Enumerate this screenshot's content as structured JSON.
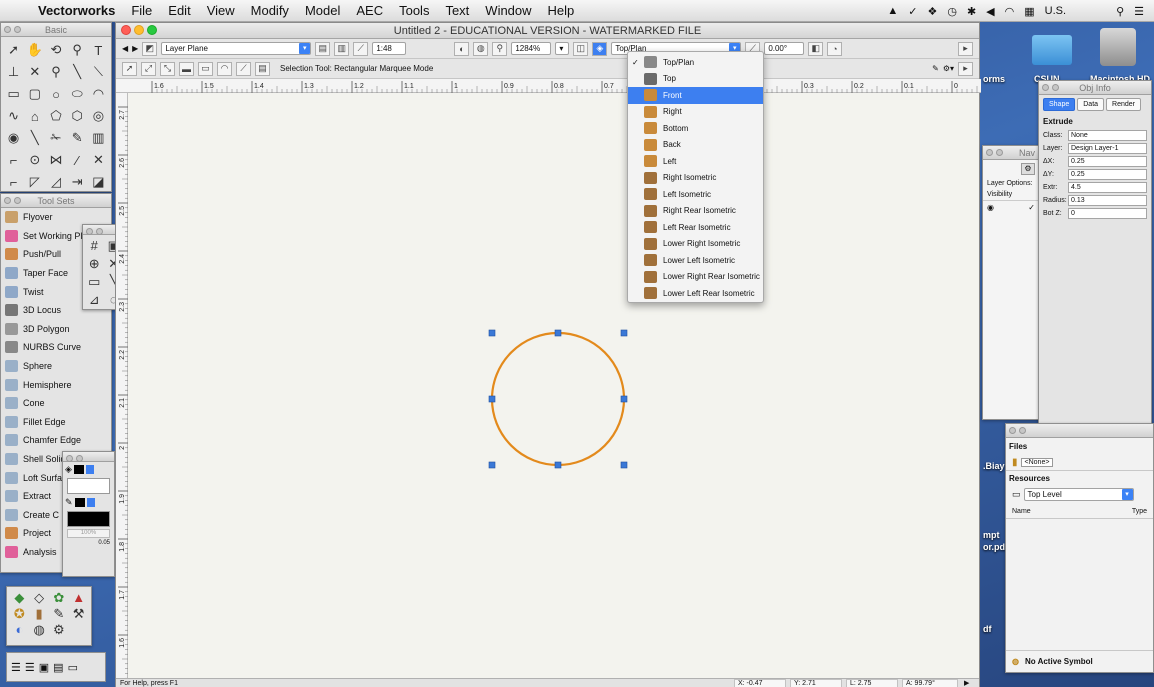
{
  "menubar": {
    "app": "Vectorworks",
    "items": [
      "File",
      "Edit",
      "View",
      "Modify",
      "Model",
      "AEC",
      "Tools",
      "Text",
      "Window",
      "Help"
    ],
    "status_locale": "U.S."
  },
  "basic_palette": {
    "title": "Basic"
  },
  "toolsets_palette": {
    "title": "Tool Sets",
    "tools": [
      {
        "label": "Flyover",
        "icon": "flyover-icon",
        "color": "#c9a06a"
      },
      {
        "label": "Set Working Pl...",
        "icon": "working-plane-icon",
        "color": "#e0609a"
      },
      {
        "label": "Push/Pull",
        "icon": "push-pull-icon",
        "color": "#d08a4a"
      },
      {
        "label": "Taper Face",
        "icon": "taper-face-icon",
        "color": "#8fa8c8"
      },
      {
        "label": "Twist",
        "icon": "twist-icon",
        "color": "#8fa8c8"
      },
      {
        "label": "3D Locus",
        "icon": "locus-icon",
        "color": "#777777"
      },
      {
        "label": "3D Polygon",
        "icon": "polygon-3d-icon",
        "color": "#999999"
      },
      {
        "label": "NURBS Curve",
        "icon": "nurbs-curve-icon",
        "color": "#888888"
      },
      {
        "label": "Sphere",
        "icon": "sphere-icon",
        "color": "#9ab0c8"
      },
      {
        "label": "Hemisphere",
        "icon": "hemisphere-icon",
        "color": "#9ab0c8"
      },
      {
        "label": "Cone",
        "icon": "cone-icon",
        "color": "#9ab0c8"
      },
      {
        "label": "Fillet Edge",
        "icon": "fillet-edge-icon",
        "color": "#9ab0c8"
      },
      {
        "label": "Chamfer Edge",
        "icon": "chamfer-edge-icon",
        "color": "#9ab0c8"
      },
      {
        "label": "Shell Solid",
        "icon": "shell-solid-icon",
        "color": "#9ab0c8"
      },
      {
        "label": "Loft Surfa",
        "icon": "loft-surface-icon",
        "color": "#9ab0c8"
      },
      {
        "label": "Extract",
        "icon": "extract-icon",
        "color": "#9ab0c8"
      },
      {
        "label": "Create C",
        "icon": "create-contours-icon",
        "color": "#9ab0c8"
      },
      {
        "label": "Project",
        "icon": "project-icon",
        "color": "#d08a4a"
      },
      {
        "label": "Analysis",
        "icon": "analysis-icon",
        "color": "#e0609a"
      }
    ]
  },
  "attributes": {
    "opacity": "100%",
    "line_weight": "0.05"
  },
  "window": {
    "title": "Untitled 2 - EDUCATIONAL VERSION - WATERMARKED FILE",
    "layer_field": "Layer Plane",
    "scale_field": "1:48",
    "zoom_field": "1284%",
    "view_field": "Top/Plan",
    "angle_field": "0.00°",
    "mode_text": "Selection Tool: Rectangular Marquee Mode",
    "ruler_ticks": [
      "1.6",
      "1.5",
      "1.4",
      "1.3",
      "1.2",
      "1.1",
      "1",
      "0.9",
      "0.8",
      "0.7",
      "0.4",
      "0.3",
      "0.2",
      "0.1",
      "0"
    ],
    "ruler_v_ticks": [
      "2.7",
      "2.6",
      "2.5",
      "2.4",
      "2.3",
      "2.2",
      "2.1",
      "2",
      "1.9",
      "1.8",
      "1.7",
      "1.6"
    ],
    "status": {
      "help": "For Help, press F1",
      "x": "X: -0.47",
      "y": "Y: 2.71",
      "l": "L: 2.75",
      "a": "A: 99.79°"
    }
  },
  "view_menu": {
    "selected": "Front",
    "items": [
      {
        "label": "Top/Plan",
        "checked": true,
        "icon": "top-plan-icon",
        "color": "#888888"
      },
      {
        "label": "Top",
        "icon": "top-view-icon",
        "color": "#6a6a6a"
      },
      {
        "label": "Front",
        "icon": "front-view-icon",
        "color": "#c98a3a"
      },
      {
        "label": "Right",
        "icon": "right-view-icon",
        "color": "#c98a3a"
      },
      {
        "label": "Bottom",
        "icon": "bottom-view-icon",
        "color": "#c98a3a"
      },
      {
        "label": "Back",
        "icon": "back-view-icon",
        "color": "#c98a3a"
      },
      {
        "label": "Left",
        "icon": "left-view-icon",
        "color": "#c98a3a"
      },
      {
        "label": "Right Isometric",
        "icon": "right-iso-icon",
        "color": "#a0703a"
      },
      {
        "label": "Left Isometric",
        "icon": "left-iso-icon",
        "color": "#a0703a"
      },
      {
        "label": "Right Rear Isometric",
        "icon": "right-rear-iso-icon",
        "color": "#a0703a"
      },
      {
        "label": "Left Rear Isometric",
        "icon": "left-rear-iso-icon",
        "color": "#a0703a"
      },
      {
        "label": "Lower Right Isometric",
        "icon": "lower-right-iso-icon",
        "color": "#a0703a"
      },
      {
        "label": "Lower Left Isometric",
        "icon": "lower-left-iso-icon",
        "color": "#a0703a"
      },
      {
        "label": "Lower Right Rear Isometric",
        "icon": "lower-right-rear-iso-icon",
        "color": "#a0703a"
      },
      {
        "label": "Lower Left Rear Isometric",
        "icon": "lower-left-rear-iso-icon",
        "color": "#a0703a"
      }
    ]
  },
  "desktop": {
    "forms_label": "orms",
    "csun_label": "CSUN",
    "hd_label": "Macintosh HD",
    "biay_label": ".Biay",
    "mpt_label": "mpt",
    "pdf_label": "or.pdf",
    "df_label": "df"
  },
  "navigation": {
    "title": "Nav",
    "layer_options": "Layer Options:",
    "visibility": "Visibility"
  },
  "obj_info": {
    "title": "Obj Info",
    "tabs": [
      "Shape",
      "Data",
      "Render"
    ],
    "heading": "Extrude",
    "class_label": "Class:",
    "class_value": "None",
    "layer_label": "Layer:",
    "layer_value": "Design Layer-1",
    "dx_label": "ΔX:",
    "dx_value": "0.25",
    "dy_label": "ΔY:",
    "dy_value": "0.25",
    "extr_label": "Extr:",
    "extr_value": "4.5",
    "radius_label": "Radius:",
    "radius_value": "0.13",
    "botz_label": "Bot Z:",
    "botz_value": "0"
  },
  "resources": {
    "files_label": "Files",
    "none_label": "<None>",
    "heading": "Resources",
    "location": "Top Level",
    "col_name": "Name",
    "col_type": "Type",
    "footer": "No Active Symbol"
  },
  "colors": {
    "circle": "#e38a1c",
    "handle": "#3a78d6",
    "accent": "#3d7ff0"
  }
}
